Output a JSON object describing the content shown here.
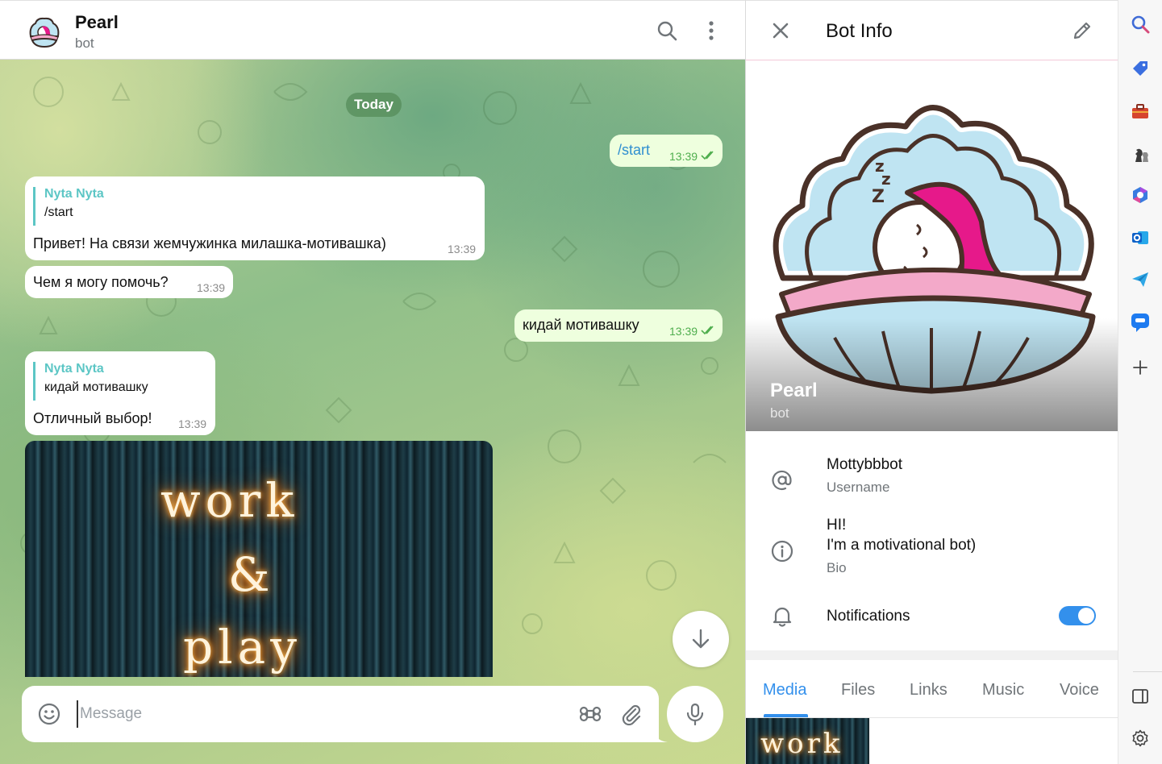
{
  "chat": {
    "title": "Pearl",
    "subtitle": "bot",
    "date_label": "Today",
    "messages": [
      {
        "dir": "out",
        "text": "/start",
        "time": "13:39"
      },
      {
        "dir": "in",
        "reply_name": "Nyta Nyta",
        "reply_text": "/start",
        "text": "Привет! На связи жемчужинка милашка-мотивашка)",
        "time": "13:39"
      },
      {
        "dir": "in",
        "text": "Чем я могу помочь?",
        "time": "13:39"
      },
      {
        "dir": "out",
        "text": "кидай мотивашку",
        "time": "13:39"
      },
      {
        "dir": "in",
        "reply_name": "Nyta Nyta",
        "reply_text": "кидай мотивашку",
        "text": "Отличный выбор!",
        "time": "13:39"
      }
    ],
    "image_text": [
      "work",
      "&",
      "play"
    ],
    "composer_placeholder": "Message"
  },
  "info": {
    "title": "Bot Info",
    "name": "Pearl",
    "status": "bot",
    "username": "Mottybbbot",
    "username_label": "Username",
    "bio_line1": "HI!",
    "bio_line2": "I'm a motivational bot)",
    "bio_label": "Bio",
    "notifications_label": "Notifications",
    "notifications_on": true,
    "tabs": [
      "Media",
      "Files",
      "Links",
      "Music",
      "Voice"
    ],
    "active_tab": "Media",
    "thumb_text": "work"
  },
  "sidebar": {
    "icons": [
      "search-icon",
      "tag-icon",
      "toolbox-icon",
      "chess-icon",
      "copilot-icon",
      "outlook-icon",
      "send-icon",
      "chat-icon",
      "add-icon",
      "split-view-icon",
      "settings-icon"
    ]
  },
  "colors": {
    "accent": "#3390ec",
    "reply_name": "#5cc6c5",
    "outgoing_bubble": "#eeffde",
    "time_out": "#4fae4e"
  }
}
